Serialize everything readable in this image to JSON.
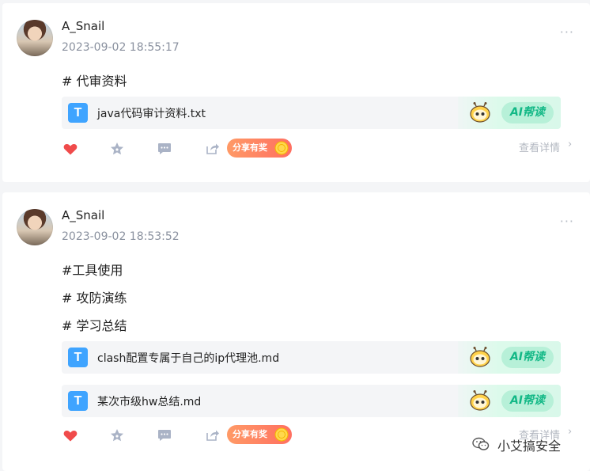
{
  "posts": [
    {
      "author": "A_Snail",
      "timestamp": "2023-09-02 18:55:17",
      "more": "···",
      "tags": [
        "# 代审资料"
      ],
      "files": [
        {
          "icon_letter": "T",
          "name": "java代码审计资料.txt",
          "ai_label": "AI帮读"
        }
      ],
      "share_label": "分享有奖",
      "details_label": "查看详情"
    },
    {
      "author": "A_Snail",
      "timestamp": "2023-09-02 18:53:52",
      "more": "···",
      "tags": [
        "#工具使用",
        "# 攻防演练",
        "# 学习总结"
      ],
      "files": [
        {
          "icon_letter": "T",
          "name": "clash配置专属于自己的ip代理池.md",
          "ai_label": "AI帮读"
        },
        {
          "icon_letter": "T",
          "name": "某次市级hw总结.md",
          "ai_label": "AI帮读"
        }
      ],
      "share_label": "分享有奖",
      "details_label": "查看详情"
    }
  ],
  "watermark": {
    "text": "小艾搞安全",
    "icon": "wechat-icon"
  },
  "colors": {
    "like": "#f04b4b",
    "icon_gray": "#aab3c6",
    "ai_green": "#12b886",
    "file_icon": "#3fa4ff",
    "share_gradient_start": "#ff9a66",
    "share_gradient_end": "#ff6f61"
  }
}
